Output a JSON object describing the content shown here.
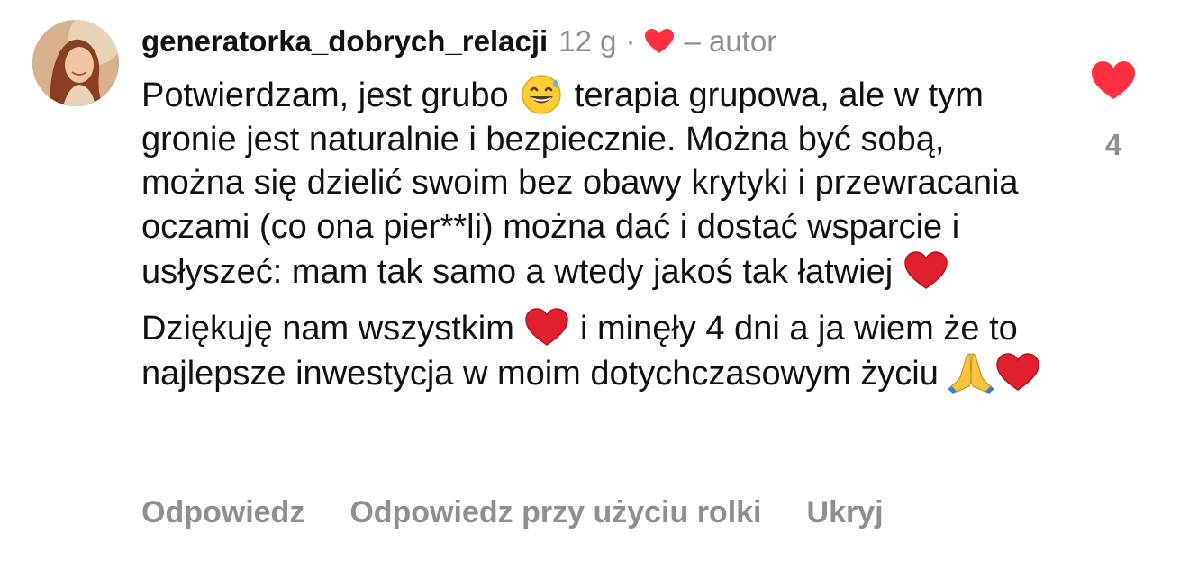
{
  "comment": {
    "username": "generatorka_dobrych_relacji",
    "time": "12 g",
    "separator": "·",
    "author_label": "– autor",
    "paragraph1": {
      "a": "Potwierdzam, jest grubo",
      "b": "terapia grupowa, ale w tym gronie jest naturalnie i bezpiecznie. Można być sobą, można się dzielić swoim bez obawy krytyki i przewracania oczami (co ona pier**li) można dać i dostać wsparcie i usłyszeć: mam tak samo a wtedy jakoś tak łatwiej"
    },
    "paragraph2": {
      "a": "Dziękuję nam wszystkim",
      "b": "i minęły 4 dni a ja wiem że to najlepsze inwestycja w moim dotychczasowym życiu"
    },
    "like_count": "4"
  },
  "actions": {
    "reply": "Odpowiedz",
    "reply_reel": "Odpowiedz przy użyciu rolki",
    "hide": "Ukryj"
  },
  "icons": {
    "avatar": "profile-avatar",
    "author_like": "heart-icon",
    "emoji_sweat": "grinning-face-with-sweat-emoji",
    "emoji_heart": "red-heart-emoji",
    "emoji_pray": "folded-hands-emoji",
    "like": "heart-icon"
  },
  "colors": {
    "heart": "#ff3040",
    "secondary_text": "#8e8e93",
    "text": "#111111"
  }
}
